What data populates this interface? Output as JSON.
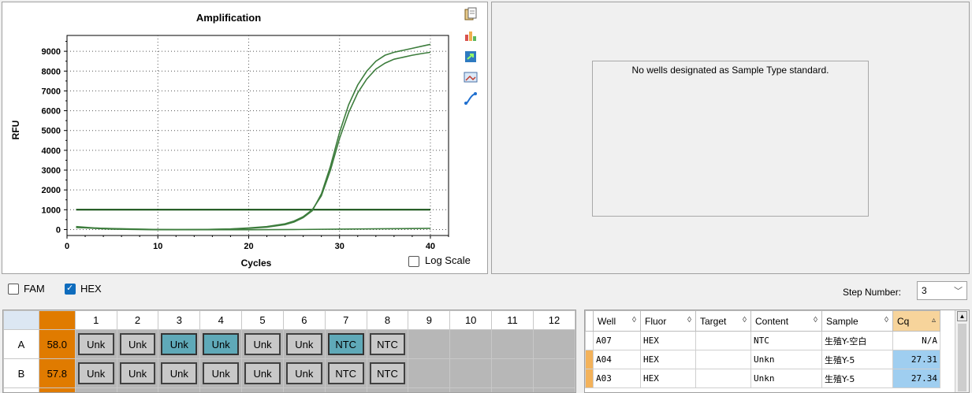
{
  "chart_panel": {
    "log_scale_label": "Log Scale",
    "log_scale_checked": false
  },
  "chart_data": {
    "type": "line",
    "title": "Amplification",
    "xlabel": "Cycles",
    "ylabel": "RFU",
    "xlim": [
      0,
      42
    ],
    "ylim": [
      -300,
      9800
    ],
    "x_ticks": [
      0,
      10,
      20,
      30,
      40
    ],
    "y_ticks": [
      0,
      1000,
      2000,
      3000,
      4000,
      5000,
      6000,
      7000,
      8000,
      9000
    ],
    "grid": "dotted",
    "threshold": 1000,
    "series": [
      {
        "color": "#3d7d3d",
        "x": [
          1,
          3,
          5,
          8,
          10,
          12,
          15,
          18,
          20,
          22,
          24,
          25,
          26,
          27,
          28,
          29,
          30,
          31,
          32,
          33,
          34,
          35,
          36,
          37,
          38,
          39,
          40
        ],
        "y": [
          150,
          80,
          40,
          10,
          0,
          -5,
          0,
          20,
          60,
          120,
          250,
          380,
          600,
          950,
          1800,
          3200,
          4900,
          6300,
          7300,
          8000,
          8500,
          8800,
          8950,
          9050,
          9150,
          9250,
          9350
        ]
      },
      {
        "color": "#3d7d3d",
        "x": [
          1,
          3,
          5,
          8,
          10,
          12,
          15,
          18,
          20,
          22,
          24,
          25,
          26,
          27,
          28,
          29,
          30,
          31,
          32,
          33,
          34,
          35,
          36,
          37,
          38,
          39,
          40
        ],
        "y": [
          120,
          60,
          20,
          0,
          -10,
          -10,
          0,
          30,
          80,
          150,
          290,
          430,
          650,
          1000,
          1700,
          3000,
          4600,
          5900,
          6900,
          7600,
          8100,
          8400,
          8600,
          8700,
          8800,
          8880,
          8950
        ]
      },
      {
        "color": "#3d7d3d",
        "x": [
          1,
          5,
          10,
          15,
          20,
          25,
          30,
          35,
          40
        ],
        "y": [
          100,
          50,
          0,
          -10,
          -10,
          0,
          20,
          40,
          60
        ]
      }
    ]
  },
  "standard_panel": {
    "message": "No wells designated as Sample Type standard."
  },
  "filters": {
    "fam_label": "FAM",
    "fam_checked": false,
    "hex_label": "HEX",
    "hex_checked": true,
    "step_label": "Step Number:",
    "step_value": "3"
  },
  "plate": {
    "columns": [
      "1",
      "2",
      "3",
      "4",
      "5",
      "6",
      "7",
      "8",
      "9",
      "10",
      "11",
      "12"
    ],
    "rows": [
      {
        "label": "A",
        "temp": "58.0",
        "wells": [
          "Unk",
          "Unk",
          "Unk",
          "Unk",
          "Unk",
          "Unk",
          "NTC",
          "NTC",
          "",
          "",
          "",
          ""
        ],
        "selected": [
          false,
          false,
          true,
          true,
          false,
          false,
          true,
          false,
          false,
          false,
          false,
          false
        ]
      },
      {
        "label": "B",
        "temp": "57.8",
        "wells": [
          "Unk",
          "Unk",
          "Unk",
          "Unk",
          "Unk",
          "Unk",
          "NTC",
          "NTC",
          "",
          "",
          "",
          ""
        ],
        "selected": [
          false,
          false,
          false,
          false,
          false,
          false,
          false,
          false,
          false,
          false,
          false,
          false
        ]
      }
    ]
  },
  "results": {
    "headers": [
      "Well",
      "Fluor",
      "Target",
      "Content",
      "Sample",
      "Cq"
    ],
    "rows": [
      {
        "well": "A07",
        "fluor": "HEX",
        "target": "",
        "content": "NTC",
        "sample": "生殖Y-空白",
        "cq": "N/A",
        "highlight": false,
        "marked": false
      },
      {
        "well": "A04",
        "fluor": "HEX",
        "target": "",
        "content": "Unkn",
        "sample": "生殖Y-5",
        "cq": "27.31",
        "highlight": true,
        "marked": true
      },
      {
        "well": "A03",
        "fluor": "HEX",
        "target": "",
        "content": "Unkn",
        "sample": "生殖Y-5",
        "cq": "27.34",
        "highlight": true,
        "marked": true
      }
    ]
  },
  "icons": [
    "copy-icon",
    "chart-settings-icon",
    "export-icon",
    "image-icon",
    "curve-icon"
  ]
}
